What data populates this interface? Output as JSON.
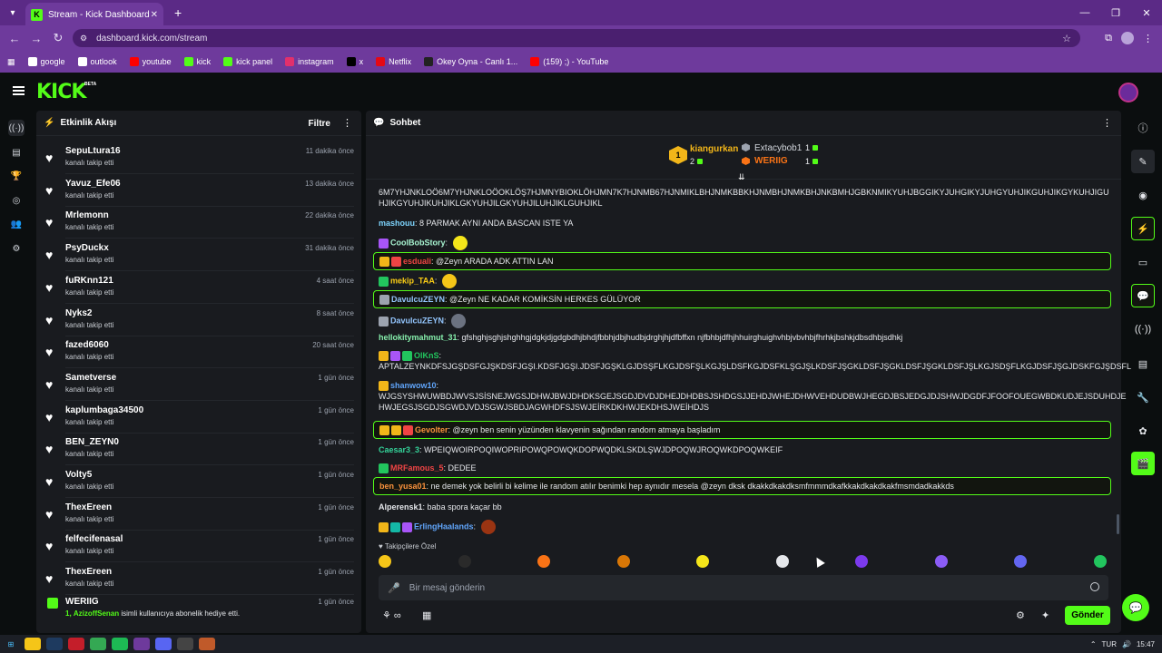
{
  "browser": {
    "tab_title": "Stream - Kick Dashboard",
    "url": "dashboard.kick.com/stream",
    "bookmarks": [
      {
        "label": "google",
        "color": "#ffffff"
      },
      {
        "label": "outlook",
        "color": "#ffffff"
      },
      {
        "label": "youtube",
        "color": "#ff0000"
      },
      {
        "label": "kick",
        "color": "#53fc18"
      },
      {
        "label": "kick panel",
        "color": "#53fc18"
      },
      {
        "label": "instagram",
        "color": "#e1306c"
      },
      {
        "label": "x",
        "color": "#000000"
      },
      {
        "label": "Netflix",
        "color": "#e50914"
      },
      {
        "label": "Okey Oyna - Canlı 1...",
        "color": "#222222"
      },
      {
        "label": "(159) ;) - YouTube",
        "color": "#ff0000"
      }
    ]
  },
  "header": {
    "logo": "KICK",
    "beta": "BETA"
  },
  "activity": {
    "title": "Etkinlik Akışı",
    "filter_label": "Filtre",
    "items": [
      {
        "name": "SepuLtura16",
        "action": "kanalı takip etti",
        "time": "11 dakika önce"
      },
      {
        "name": "Yavuz_Efe06",
        "action": "kanalı takip etti",
        "time": "13 dakika önce"
      },
      {
        "name": "Mrlemonn",
        "action": "kanalı takip etti",
        "time": "22 dakika önce"
      },
      {
        "name": "PsyDuckx",
        "action": "kanalı takip etti",
        "time": "31 dakika önce"
      },
      {
        "name": "fuRKnn121",
        "action": "kanalı takip etti",
        "time": "4 saat önce"
      },
      {
        "name": "Nyks2",
        "action": "kanalı takip etti",
        "time": "8 saat önce"
      },
      {
        "name": "fazed6060",
        "action": "kanalı takip etti",
        "time": "20 saat önce"
      },
      {
        "name": "Sametverse",
        "action": "kanalı takip etti",
        "time": "1 gün önce"
      },
      {
        "name": "kaplumbaga34500",
        "action": "kanalı takip etti",
        "time": "1 gün önce"
      },
      {
        "name": "BEN_ZEYN0",
        "action": "kanalı takip etti",
        "time": "1 gün önce"
      },
      {
        "name": "Volty5",
        "action": "kanalı takip etti",
        "time": "1 gün önce"
      },
      {
        "name": "ThexEreen",
        "action": "kanalı takip etti",
        "time": "1 gün önce"
      },
      {
        "name": "felfecifenasal",
        "action": "kanalı takip etti",
        "time": "1 gün önce"
      },
      {
        "name": "ThexEreen",
        "action": "kanalı takip etti",
        "time": "1 gün önce"
      }
    ],
    "gift": {
      "name": "WERIIG",
      "count": "1,",
      "recipient": "AzizoffSenan",
      "text": "isimli kullanıcıya abonelik hediye etti.",
      "time": "1 gün önce"
    }
  },
  "chat": {
    "title": "Sohbet",
    "leaderboard": [
      {
        "rank": "1",
        "name": "kiangurkan",
        "value": "2"
      },
      {
        "name": "Extacybob1",
        "value": "1"
      },
      {
        "name": "WERIIG",
        "value": "1"
      }
    ],
    "messages": [
      {
        "user": "",
        "text": "6M7YHJNKLOÖ6M7YHJNKLOÖOKLÖŞ7HJMNYBIOKLÖHJMN7K7HJNMB67HJNMIKLBHJNMKBBKHJNMBHJNMKBHJNKBMHJGBKNMIKYUHJBGGIKYJUHGIKYJUHGYUHJIKGUHJIKGYKUHJIGU HJIKGYUHJIKUHJIKLGKYUHJILGKYUHJILUHJIKLGUHJIKL"
      },
      {
        "user": "mashouu",
        "text": "8 PARMAK AYNI ANDA BASCAN ISTE YA"
      },
      {
        "user": "CoolBobStory",
        "text": ""
      },
      {
        "user": "esduali",
        "text": "@Zeyn ARADA ADK ATTIN LAN"
      },
      {
        "user": "mekip_TAA",
        "text": ""
      },
      {
        "user": "DavulcuZEYN",
        "text": "@Zeyn NE KADAR KOMİKSİN HERKES GÜLÜYOR"
      },
      {
        "user": "DavulcuZEYN",
        "text": ""
      },
      {
        "user": "hellokitymahmut_31",
        "text": "gfshghjsghjshghhgjdgkjdjgdgbdhjbhdjfbbhjdbjhudbjdrghjhjdfbffxn njfbhbjdfhjhhuirghuighvhbjvbvhbjfhrhkjbshkjdbsdhbjsdhkj"
      },
      {
        "user": "OlKnS",
        "text": "APTALZEYNKDFSJGŞDSFGJŞKDSFJGŞI.KDSFJGŞI.JDSFJGŞKLGJDSŞFLKGJDSFŞLKGJŞLDSFKGJDSFKLŞGJŞLKDSFJŞGKLDSFJŞGKLDSFJŞGKLDSFJŞLKGJSDŞFLKGJDSFJŞGJDSKFGJŞDSFL"
      },
      {
        "user": "shanwow10",
        "text": "WJGSYSHWUWBDJWVSJSİSNEJWGSJDHWJBWJDHDKSGEJSGDJDVDJDHEJDHDBSJSHDGSJJEHDJWHEJDHWVEHDUDBWJHEGDJBSJEDGJDJSHWJDGDFJFOOFOUEGWBDKUDJEJSDUHDJE HWJEGSJSGDJSGWDJVDJSGWJSBDJAGWHDFSJSWJEİRKDKHWJEKDHSJWEİHDJS"
      },
      {
        "user": "Gevolter",
        "text": "@zeyn ben senin yüzünden klavyenin sağından random atmaya başladım"
      },
      {
        "user": "Caesar3_3",
        "text": "WPEIQWOIRPOQIWOPRIPOWQPOWQKDOPWQDKLSKDLŞWJDPOQWJROQWKDPOQWKEIF"
      },
      {
        "user": "MRFamous_5",
        "text": "DEDEE"
      },
      {
        "user": "ben_yusa01",
        "text": "ne demek yok belirli bi kelime ile random atılır benimki hep aynıdır mesela @zeyn dksk dkakkdkakdksmfmmmdkafkkakdkakdkakfmsmdadkakkds"
      },
      {
        "user": "Alperensk1",
        "text": "baba spora kaçar bb"
      },
      {
        "user": "ErlingHaalands",
        "text": ""
      }
    ],
    "emotes_label": "Takipçilere Özel",
    "input_placeholder": "Bir mesaj gönderin",
    "send_label": "Gönder"
  },
  "taskbar": {
    "time": "15:47",
    "lang": "TUR"
  }
}
